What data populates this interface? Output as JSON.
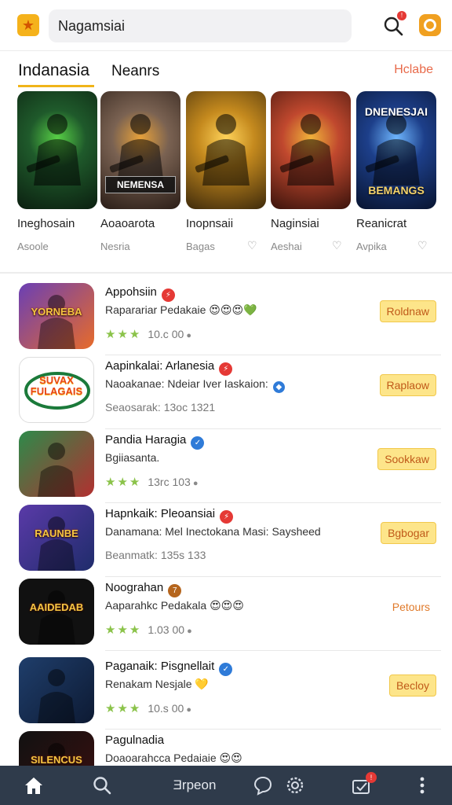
{
  "header": {
    "search_value": "Nagamsiai",
    "notification_count": "!"
  },
  "tabs": {
    "primary": "Indanasia",
    "secondary": "Neanrs",
    "more": "Hclabe"
  },
  "featured": [
    {
      "title": "Ineghosain",
      "sub": "Asoole",
      "art_text": "",
      "colors": [
        "#1f5a2b",
        "#0b1f10"
      ],
      "accent": "#58d046"
    },
    {
      "title": "Aoaoarota",
      "sub": "Nesria",
      "art_text": "NEMENSA",
      "colors": [
        "#7a6252",
        "#2a1d17"
      ],
      "accent": "#e8a23a"
    },
    {
      "title": "Inopnsaii",
      "sub": "Bagas",
      "art_text": "",
      "colors": [
        "#c58a1e",
        "#3e2a0b"
      ],
      "accent": "#ffd35a"
    },
    {
      "title": "Naginsiai",
      "sub": "Aeshai",
      "art_text": "",
      "colors": [
        "#c0482e",
        "#3a130c"
      ],
      "accent": "#f0b33a"
    },
    {
      "title": "Reanicrat",
      "sub": "Avpika",
      "art_text": "DNENESJAI",
      "art_text_2": "BEMANGS",
      "colors": [
        "#1d3f8a",
        "#081430"
      ],
      "accent": "#6fb7ff"
    }
  ],
  "apps": [
    {
      "title": "Appohsiin",
      "badge_color": "#e53935",
      "badge_glyph": "⚡",
      "sub": "Raparariar Pedakaie 😍😍😍💚",
      "meta": "10.c 00",
      "stars": "★★★",
      "button": "Roldnaw",
      "button_style": "filled",
      "icon_text": "YORNEBA",
      "icon_colors": [
        "#6a3fb5",
        "#e76b2a"
      ]
    },
    {
      "title": "Aapinkalai: Arlanesia",
      "badge_color": "#e53935",
      "badge_glyph": "⚡",
      "sub": "Naoakanae: Ndeiar Iver Iaskaion:",
      "sub_badge_color": "#2f7bd8",
      "meta": "Seaosarak: 13oc 1321",
      "stars": "",
      "button": "Raplaow",
      "button_style": "filled",
      "icon_text": "SUVAX FULAGAIS",
      "icon_colors": [
        "#ffffff",
        "#ffffff"
      ]
    },
    {
      "title": "Pandia Haragia",
      "badge_color": "#2f7bd8",
      "badge_glyph": "✓",
      "sub": "Bgiiasanta.",
      "meta": "13rc 103",
      "stars": "★★★",
      "button": "Sookkaw",
      "button_style": "filled",
      "icon_text": "",
      "icon_colors": [
        "#2d8a4a",
        "#b23030"
      ]
    },
    {
      "title": "Hapnkaik: Pleoansiai",
      "badge_color": "#e53935",
      "badge_glyph": "⚡",
      "sub": "Danamana: Mel Inectokana Masi: Saysheed",
      "meta": "Beanmatk: 135s 133",
      "stars": "",
      "button": "Bgbogar",
      "button_style": "filled",
      "icon_text": "RAUNBE",
      "icon_colors": [
        "#5a3aa8",
        "#1f2c6b"
      ]
    },
    {
      "title": "Noograhan",
      "badge_color": "#b5651d",
      "badge_glyph": "7",
      "sub": "Aaparahkc Pedakala 😍😍😍",
      "meta": "1.03 00",
      "stars": "★★★",
      "button": "Petours",
      "button_style": "plain",
      "icon_text": "AAIDEDAB",
      "icon_colors": [
        "#111111",
        "#111111"
      ]
    },
    {
      "title": "Paganaik: Pisgnellait",
      "badge_color": "#2f7bd8",
      "badge_glyph": "✓",
      "sub": "Renakam Nesjale 💛",
      "meta": "10.s 00",
      "stars": "★★★",
      "button": "Becloy",
      "button_style": "filled",
      "icon_text": "",
      "icon_colors": [
        "#1f3e6b",
        "#0d1a33"
      ]
    },
    {
      "title": "Pagulnadia",
      "badge_color": "",
      "badge_glyph": "",
      "sub": "Doaoarahcca Pedaiaie 😍😍",
      "meta": "",
      "stars": "",
      "button": "",
      "button_style": "none",
      "icon_text": "SILENCUS",
      "icon_colors": [
        "#111111",
        "#3a1010"
      ]
    }
  ],
  "bottomnav": {
    "center_label": "Ǝrpeon",
    "inbox_count": "!"
  }
}
